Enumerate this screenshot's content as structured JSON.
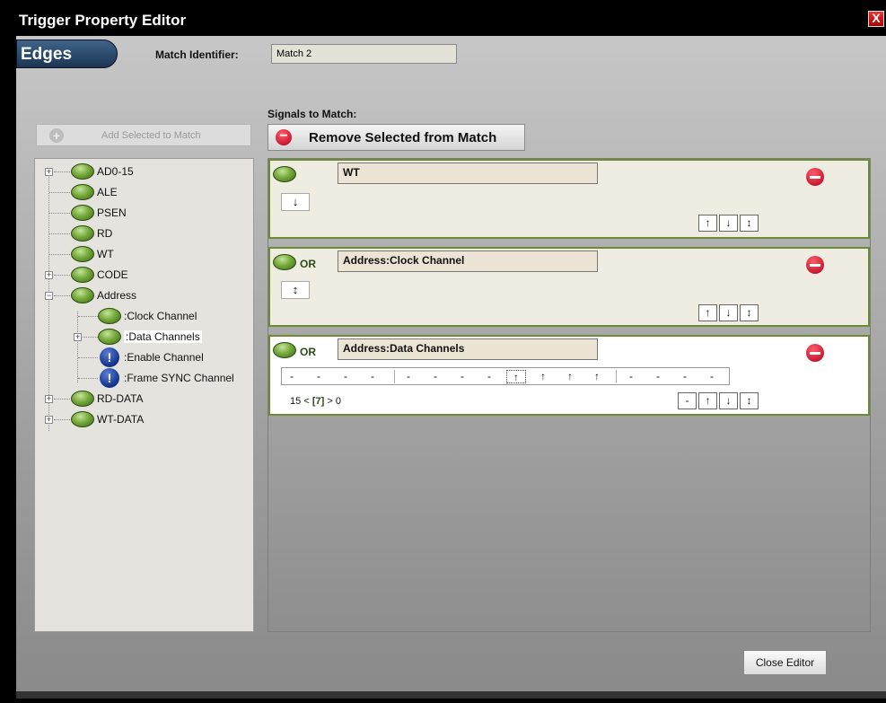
{
  "window": {
    "title": "Trigger Property Editor",
    "close_glyph": "X"
  },
  "header": {
    "tab_label": "Edges",
    "match_identifier_label": "Match Identifier:",
    "match_identifier_value": "Match 2"
  },
  "left_panel": {
    "add_button_label": "Add Selected to Match",
    "tree": [
      {
        "label": "AD0-15",
        "expandable": true
      },
      {
        "label": "ALE"
      },
      {
        "label": "PSEN"
      },
      {
        "label": "RD"
      },
      {
        "label": "WT"
      },
      {
        "label": "CODE",
        "expandable": true
      },
      {
        "label": "Address",
        "expanded": true
      },
      {
        "label": ":Clock Channel"
      },
      {
        "label": ":Data Channels",
        "expandable": true
      },
      {
        "label": ":Enable Channel",
        "icon": "warning-icon"
      },
      {
        "label": ":Frame SYNC Channel",
        "icon": "warning-icon"
      },
      {
        "label": "RD-DATA",
        "expandable": true
      },
      {
        "label": "WT-DATA",
        "expandable": true
      }
    ]
  },
  "right_panel": {
    "signals_label": "Signals to Match:",
    "remove_button_label": "Remove Selected from Match",
    "rows": [
      {
        "op": "",
        "name": "WT",
        "edge": "↓",
        "controls": [
          "↑",
          "↓",
          "↕"
        ]
      },
      {
        "op": "OR",
        "name": "Address:Clock Channel",
        "edge": "↕",
        "controls": [
          "↑",
          "↓",
          "↕"
        ]
      },
      {
        "op": "OR",
        "name": "Address:Data Channels",
        "bits": [
          "-",
          "-",
          "-",
          "-",
          "-",
          "-",
          "-",
          "-",
          "↑",
          "↑",
          "↑",
          "↑",
          "-",
          "-",
          "-",
          "-"
        ],
        "index_hi": "15",
        "index_lt": "<",
        "index_sel": "[7]",
        "index_gt": ">",
        "index_lo": "0",
        "controls": [
          "-",
          "↑",
          "↓",
          "↕"
        ]
      }
    ]
  },
  "footer": {
    "close_editor_label": "Close Editor"
  }
}
